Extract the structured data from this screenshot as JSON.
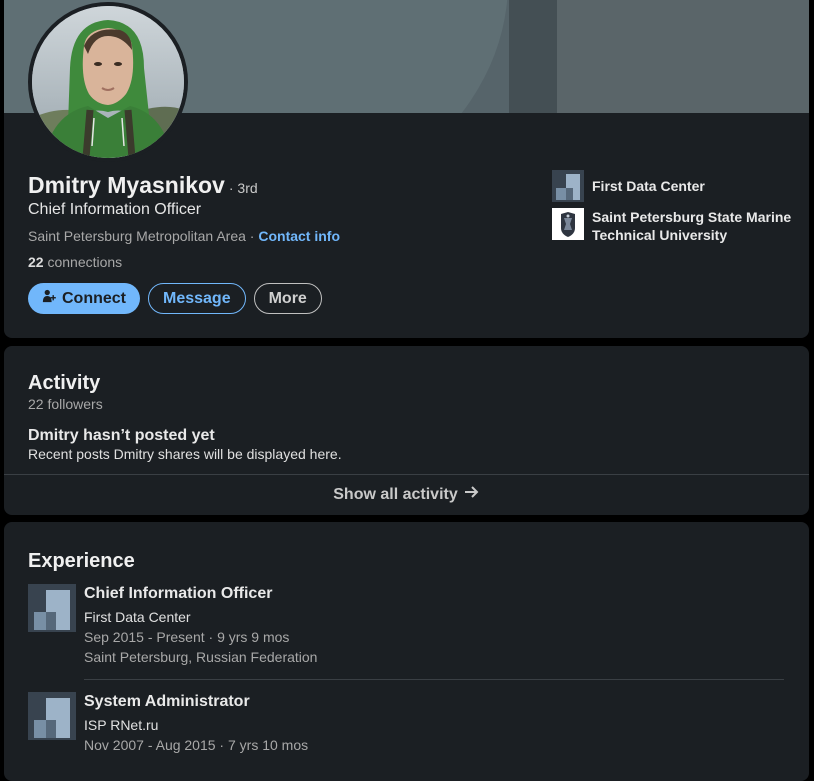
{
  "profile": {
    "name": "Dmitry Myasnikov",
    "degree": "· 3rd",
    "headline": "Chief Information Officer",
    "location": "Saint Petersburg Metropolitan Area",
    "location_separator": " · ",
    "contact_info": "Contact info",
    "connections_count": "22",
    "connections_label": " connections",
    "actions": {
      "connect": "Connect",
      "message": "Message",
      "more": "More"
    },
    "orgs": [
      {
        "name": "First Data Center",
        "logo": "company-logo-placeholder"
      },
      {
        "name": "Saint Petersburg State Marine Technical University",
        "logo": "university-crest"
      }
    ]
  },
  "activity": {
    "title": "Activity",
    "followers": "22 followers",
    "empty_title": "Dmitry hasn’t posted yet",
    "empty_subtitle": "Recent posts Dmitry shares will be displayed here.",
    "show_all": "Show all activity",
    "show_all_icon": "arrow-right-icon"
  },
  "experience": {
    "title": "Experience",
    "items": [
      {
        "title": "Chief Information Officer",
        "company": "First Data Center",
        "dates": "Sep 2015 - Present · 9 yrs 9 mos",
        "location": "Saint Petersburg, Russian Federation"
      },
      {
        "title": "System Administrator",
        "company": "ISP RNet.ru",
        "dates": "Nov 2007 - Aug 2015 · 7 yrs 10 mos"
      }
    ]
  },
  "colors": {
    "background": "#000000",
    "card": "#1b1f23",
    "accent": "#71b7fb",
    "text_primary": "#e9e9e9",
    "text_secondary": "#a8a8a8",
    "banner": "#56646a"
  }
}
